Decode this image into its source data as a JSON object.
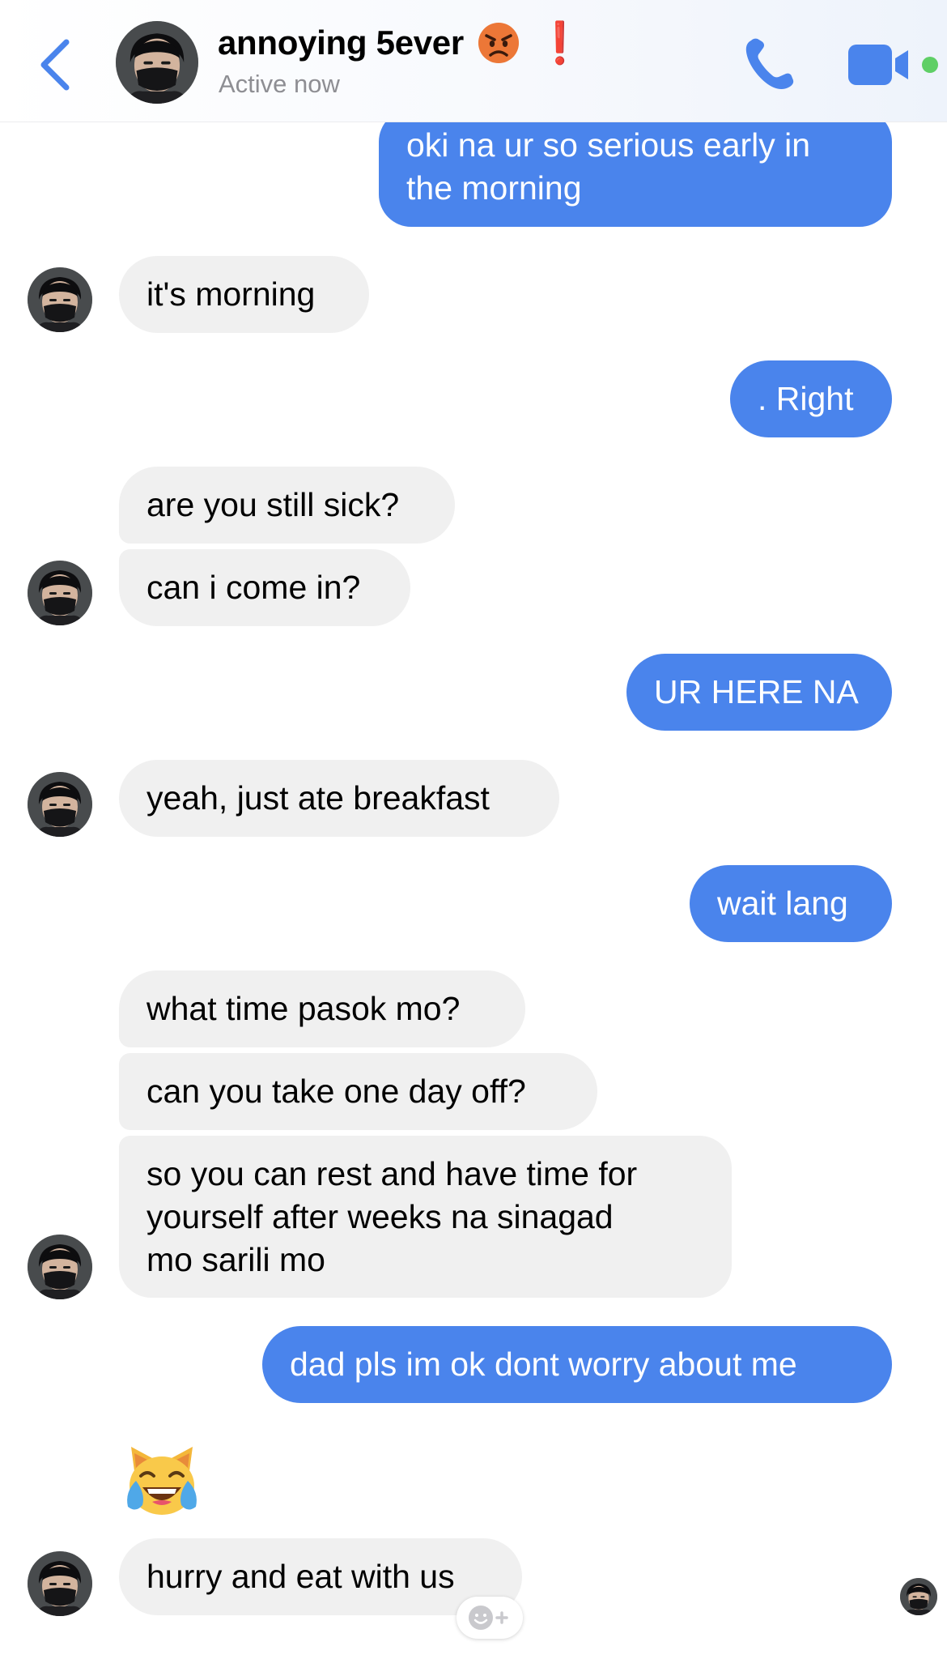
{
  "header": {
    "contact_name": "annoying 5ever",
    "name_suffix": "❗",
    "status": "Active now"
  },
  "messages": [
    {
      "from": "me",
      "lines": [
        "oki na ur so serious early in",
        "the morning"
      ]
    },
    {
      "from": "contact",
      "lines": [
        "it's morning"
      ]
    },
    {
      "from": "me",
      "lines": [
        ". Right"
      ]
    },
    {
      "from": "contact",
      "lines": [
        "are you still sick?"
      ]
    },
    {
      "from": "contact",
      "lines": [
        "can i come in?"
      ]
    },
    {
      "from": "me",
      "lines": [
        "UR HERE NA"
      ]
    },
    {
      "from": "contact",
      "lines": [
        "yeah, just ate breakfast"
      ]
    },
    {
      "from": "me",
      "lines": [
        "wait lang"
      ]
    },
    {
      "from": "contact",
      "lines": [
        "what time pasok mo?"
      ]
    },
    {
      "from": "contact",
      "lines": [
        "can you take one day off?"
      ]
    },
    {
      "from": "contact",
      "lines": [
        "so you can rest and have time for",
        "yourself after weeks na sinagad",
        "mo sarili mo"
      ]
    },
    {
      "from": "me",
      "lines": [
        "dad pls im ok dont worry about me"
      ]
    },
    {
      "from": "contact",
      "emoji": "crying-laughing-cat"
    },
    {
      "from": "contact",
      "lines": [
        "hurry and eat with us"
      ]
    }
  ],
  "colors": {
    "accent": "#4a84ec",
    "incoming_bubble": "#f0f0f0",
    "outgoing_text": "#ffffff",
    "status_text": "#8e8e93",
    "active_dot": "#5fcf66",
    "exclamation": "#e01b1b"
  },
  "icons": {
    "back": "chevron-left-icon",
    "call": "phone-icon",
    "video": "video-camera-icon",
    "react": "add-reaction-icon"
  }
}
